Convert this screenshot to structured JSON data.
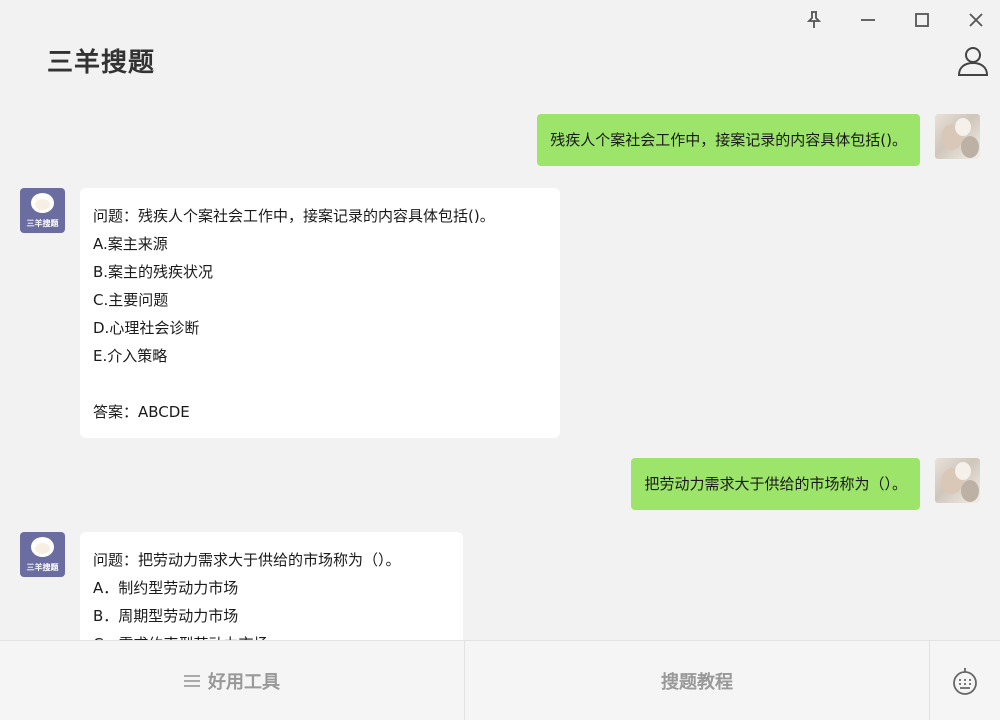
{
  "app": {
    "title": "三羊搜题"
  },
  "window_controls": [
    "pin-icon",
    "minimize-icon",
    "maximize-icon",
    "close-icon"
  ],
  "messages": [
    {
      "role": "user",
      "text": "残疾人个案社会工作中，接案记录的内容具体包括()。"
    },
    {
      "role": "bot",
      "lines": [
        "问题：残疾人个案社会工作中，接案记录的内容具体包括()。",
        "A.案主来源",
        "B.案主的残疾状况",
        "C.主要问题",
        "D.心理社会诊断",
        "E.介入策略",
        "",
        "答案：ABCDE"
      ]
    },
    {
      "role": "user",
      "text": "把劳动力需求大于供给的市场称为（）。"
    },
    {
      "role": "bot",
      "lines": [
        "问题：把劳动力需求大于供给的市场称为（）。",
        "A．制约型劳动力市场",
        "B．周期型劳动力市场",
        "C．需求约束型劳动力市场"
      ]
    }
  ],
  "bot_avatar_label": "三羊搜题",
  "bottom_bar": {
    "tools_label": "好用工具",
    "tutorial_label": "搜题教程"
  },
  "colors": {
    "user_bubble": "#9de46a",
    "bot_bubble": "#ffffff",
    "background": "#f2f2f2",
    "bot_avatar": "#6b6c9f"
  }
}
